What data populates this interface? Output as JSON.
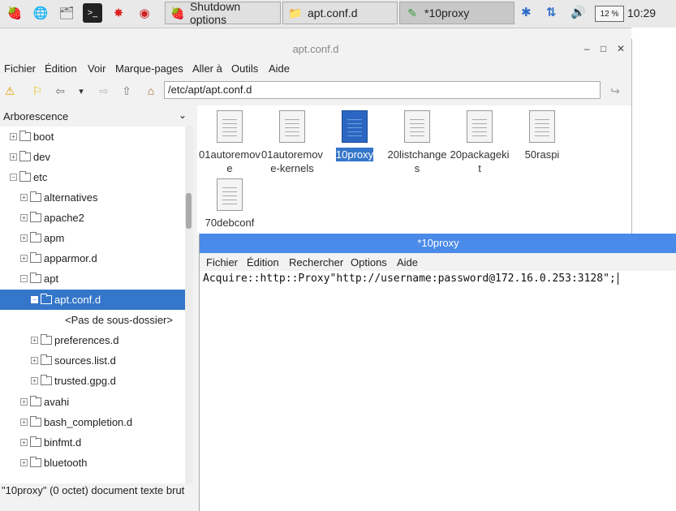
{
  "taskbar": {
    "tasks": [
      {
        "label": "Shutdown options",
        "icon": "raspberry-icon"
      },
      {
        "label": "apt.conf.d",
        "icon": "folder-icon"
      },
      {
        "label": "*10proxy",
        "icon": "text-editor-icon"
      }
    ],
    "battery": "12 %",
    "clock": "10:29"
  },
  "file_manager": {
    "title": "apt.conf.d",
    "menu": [
      "Fichier",
      "Édition",
      "Voir",
      "Marque-pages",
      "Aller à",
      "Outils",
      "Aide"
    ],
    "path": "/etc/apt/apt.conf.d",
    "sidebar_header": "Arborescence",
    "tree": [
      {
        "label": "boot",
        "exp": "+"
      },
      {
        "label": "dev",
        "exp": "+"
      },
      {
        "label": "etc",
        "exp": "−"
      },
      {
        "label": "alternatives",
        "exp": "+"
      },
      {
        "label": "apache2",
        "exp": "+"
      },
      {
        "label": "apm",
        "exp": "+"
      },
      {
        "label": "apparmor.d",
        "exp": "+"
      },
      {
        "label": "apt",
        "exp": "−"
      },
      {
        "label": "apt.conf.d",
        "exp": "−"
      },
      {
        "label": "<Pas de sous-dossier>",
        "exp": ""
      },
      {
        "label": "preferences.d",
        "exp": "+"
      },
      {
        "label": "sources.list.d",
        "exp": "+"
      },
      {
        "label": "trusted.gpg.d",
        "exp": "+"
      },
      {
        "label": "avahi",
        "exp": "+"
      },
      {
        "label": "bash_completion.d",
        "exp": "+"
      },
      {
        "label": "binfmt.d",
        "exp": "+"
      },
      {
        "label": "bluetooth",
        "exp": "+"
      }
    ],
    "files": [
      {
        "name": "01autoremove"
      },
      {
        "name": "01autoremove-kernels"
      },
      {
        "name": "10proxy"
      },
      {
        "name": "20listchanges"
      },
      {
        "name": "20packagekit"
      },
      {
        "name": "50raspi"
      },
      {
        "name": "70debconf"
      }
    ],
    "status": "\"10proxy\" (0 octet) document texte brut"
  },
  "editor": {
    "title": "*10proxy",
    "menu": [
      "Fichier",
      "Édition",
      "Rechercher",
      "Options",
      "Aide"
    ],
    "content": "Acquire::http::Proxy\"http://username:password@172.16.0.253:3128\";"
  }
}
